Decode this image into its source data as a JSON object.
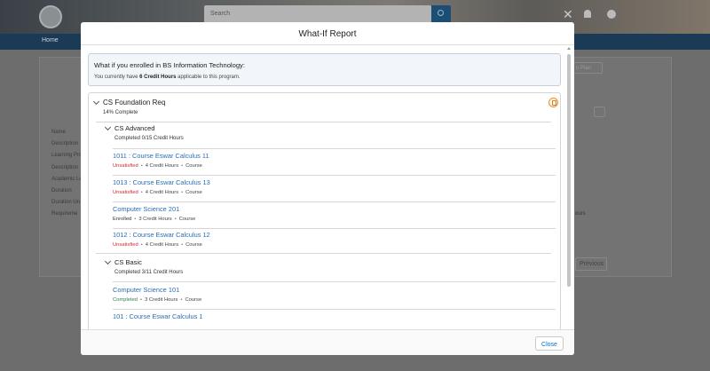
{
  "background": {
    "search_placeholder": "Search",
    "nav_home": "Home",
    "labels": [
      "Name",
      "Description",
      "Learning Pro",
      "Description",
      "Academic Le",
      "Duration",
      "Duration Un",
      "Requireme"
    ],
    "right_button": "n Plan",
    "hours_text": "ours",
    "previous_button": "Previous"
  },
  "modal": {
    "title": "What-If Report",
    "banner": {
      "title": "What if you enrolled in BS Information Technology:",
      "prefix": "You currently have ",
      "hours": "6 Credit Hours",
      "suffix": " applicable to this program."
    },
    "requirement": {
      "title": "CS Foundation Req",
      "progress": "14% Complete"
    },
    "groups": [
      {
        "title": "CS Advanced",
        "subtitle": "Completed 0/15 Credit Hours",
        "courses": [
          {
            "name": "1011 : Course Eswar Calculus 11",
            "status": "Unsatisfied",
            "hours": "4 Credit Hours",
            "type": "Course"
          },
          {
            "name": "1013 : Course Eswar Calculus 13",
            "status": "Unsatisfied",
            "hours": "4 Credit Hours",
            "type": "Course"
          },
          {
            "name": "Computer Science 201",
            "status": "Enrolled",
            "hours": "3 Credit Hours",
            "type": "Course"
          },
          {
            "name": "1012 : Course Eswar Calculus 12",
            "status": "Unsatisfied",
            "hours": "4 Credit Hours",
            "type": "Course"
          }
        ]
      },
      {
        "title": "CS Basic",
        "subtitle": "Completed 3/11 Credit Hours",
        "courses": [
          {
            "name": "Computer Science 101",
            "status": "Completed",
            "hours": "3 Credit Hours",
            "type": "Course"
          },
          {
            "name": "101 : Course Eswar Calculus 1",
            "status": "",
            "hours": "",
            "type": ""
          }
        ]
      }
    ],
    "close_label": "Close"
  },
  "colors": {
    "link": "#2a6db5",
    "unsatisfied": "#d3262c",
    "completed": "#2e844a",
    "nav": "#1a3a55"
  }
}
